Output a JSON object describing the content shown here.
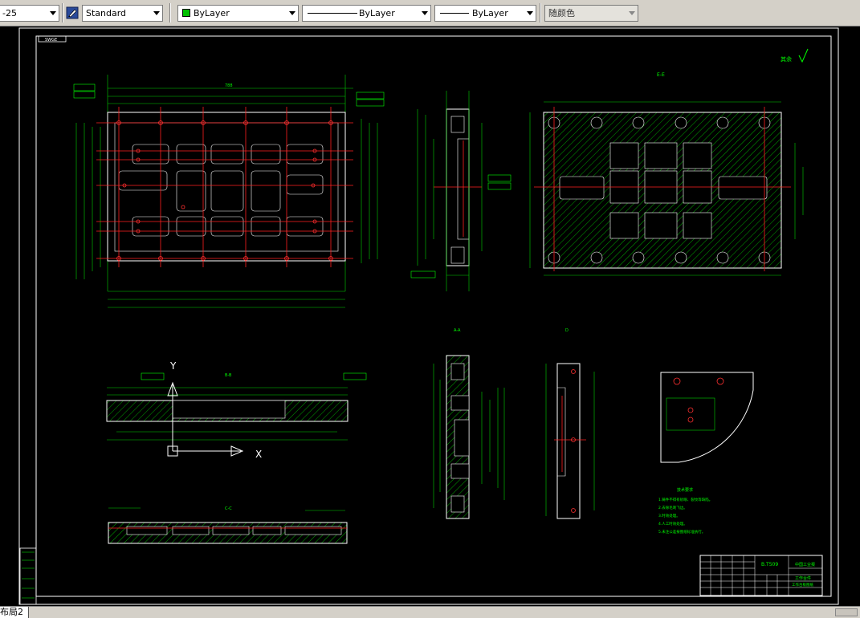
{
  "toolbar": {
    "dimstyle_value": "-25",
    "textstyle_value": "Standard",
    "layer_color_value": "ByLayer",
    "linetype_value": "ByLayer",
    "lineweight_value": "ByLayer",
    "plotstyle_value": "随颜色",
    "layer_color_hex": "#00c000"
  },
  "drawing": {
    "corner_tag": "SWGE",
    "section_ee": "E-E",
    "section_aa": "A-A",
    "section_bb": "B-B",
    "section_cc": "C-C",
    "section_d": "D",
    "ucs_y": "Y",
    "ucs_x": "X",
    "roughness_note": "其余",
    "dim_overall_width": "788",
    "title_block_code": "B.T509",
    "title_block_company": "中国工业报",
    "title_block_part": "工作台件",
    "title_block_line": "工作台板图纸",
    "notes": [
      "技术要求",
      "1.铸件不得有砂眼、裂纹等缺陷。",
      "2.去除毛刺飞边。",
      "3.时效处理。",
      "4.人工时效处理。",
      "5.未注公差按图纸标准执行。"
    ]
  },
  "tabs": {
    "layout2": "布局2"
  }
}
